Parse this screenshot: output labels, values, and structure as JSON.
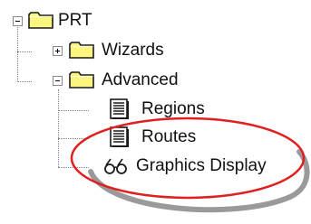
{
  "tree": {
    "root": {
      "label": "PRT",
      "icon": "folder-icon",
      "expanded": true
    },
    "children": [
      {
        "label": "Wizards",
        "icon": "folder-icon",
        "expanded": false
      },
      {
        "label": "Advanced",
        "icon": "folder-icon",
        "expanded": true,
        "children": [
          {
            "label": "Regions",
            "icon": "document-icon"
          },
          {
            "label": "Routes",
            "icon": "document-icon"
          },
          {
            "label": "Graphics Display",
            "icon": "glasses-icon"
          }
        ]
      }
    ]
  },
  "colors": {
    "folder": "#fcf57e",
    "folder_outline": "#1a1a1a",
    "highlight_ring": "#e02020",
    "shadow_ring": "#9a9a9a",
    "tree_lines": "#808080"
  }
}
